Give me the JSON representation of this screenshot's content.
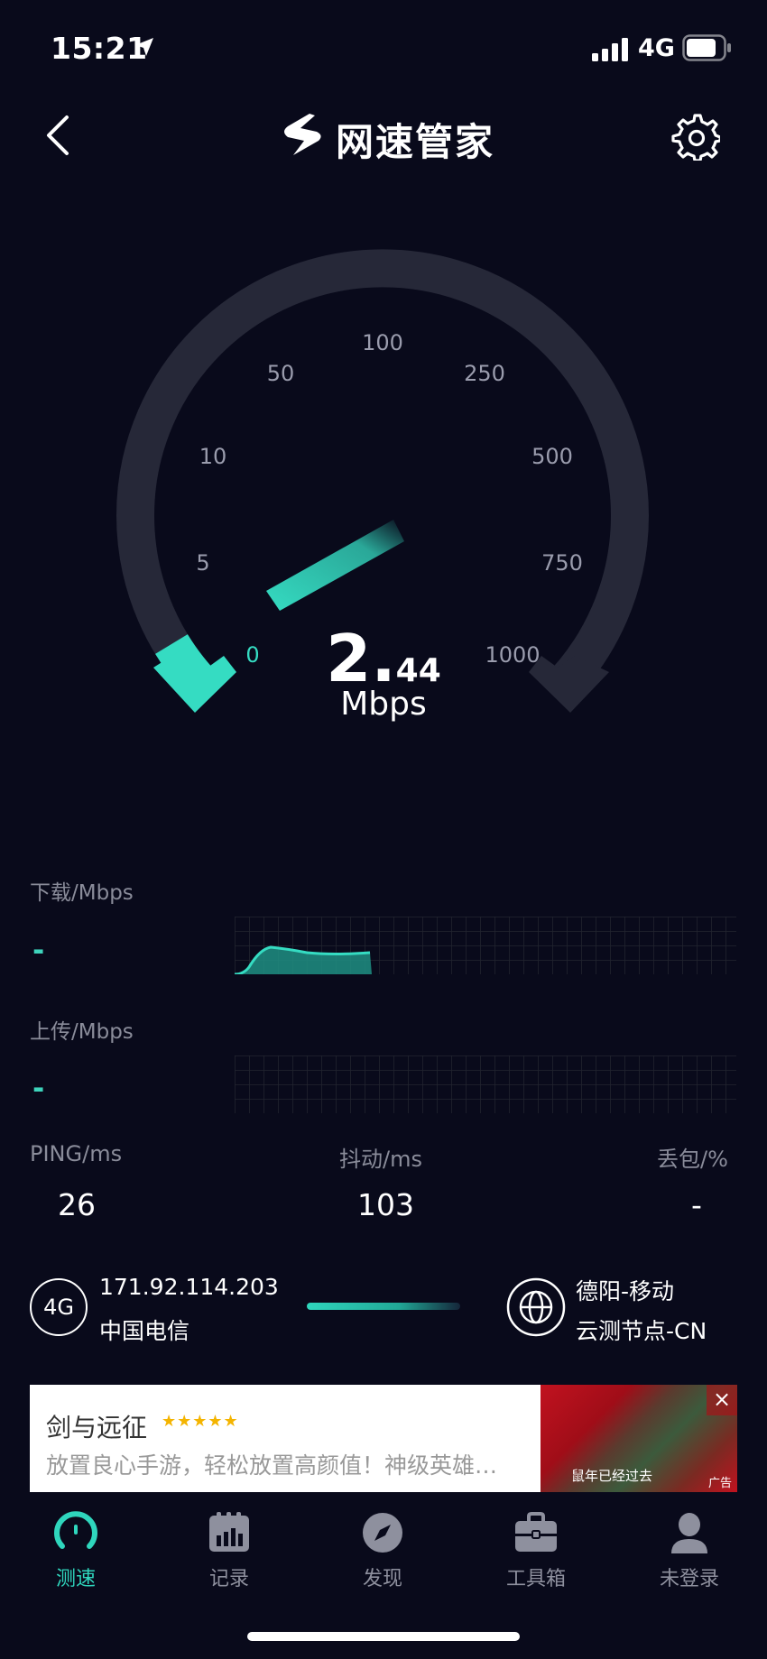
{
  "status_bar": {
    "time": "15:21",
    "network": "4G"
  },
  "header": {
    "title": "网速管家"
  },
  "gauge": {
    "tick_labels": [
      "0",
      "5",
      "10",
      "50",
      "100",
      "250",
      "500",
      "750",
      "1000"
    ],
    "current_speed_int": "2.",
    "current_speed_dec": "44",
    "current_speed_value": 2.44,
    "unit": "Mbps"
  },
  "download": {
    "label": "下载/Mbps",
    "value": "-"
  },
  "upload": {
    "label": "上传/Mbps",
    "value": "-"
  },
  "stats": {
    "ping_label": "PING/ms",
    "ping_value": "26",
    "jitter_label": "抖动/ms",
    "jitter_value": "103",
    "loss_label": "丢包/%",
    "loss_value": "-"
  },
  "connection": {
    "type": "4G",
    "ip": "171.92.114.203",
    "isp": "中国电信",
    "node_location": "德阳-移动",
    "node_name": "云测节点-CN"
  },
  "ad": {
    "title": "剑与远征",
    "stars": "★★★★★",
    "description": "放置良心手游，轻松放置高颜值！神级英雄…",
    "image_caption": "鼠年已经过去",
    "tag": "广告"
  },
  "nav": {
    "items": [
      {
        "label": "测速",
        "active": true
      },
      {
        "label": "记录",
        "active": false
      },
      {
        "label": "发现",
        "active": false
      },
      {
        "label": "工具箱",
        "active": false
      },
      {
        "label": "未登录",
        "active": false
      }
    ]
  },
  "colors": {
    "accent": "#2fd6bd",
    "background": "#090a1b",
    "gauge_track": "#262838"
  }
}
